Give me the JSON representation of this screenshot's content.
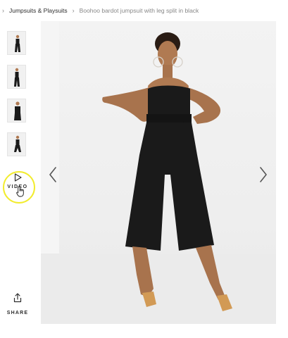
{
  "breadcrumb": {
    "items": [
      {
        "label": "Jumpsuits & Playsuits"
      }
    ],
    "current": "Boohoo bardot jumpsuit with leg split in black"
  },
  "gallery": {
    "thumbnail_count": 4,
    "video_label": "VIDEO",
    "share_label": "SHARE"
  },
  "colors": {
    "garment": "#1a1a1a",
    "skin": "#b07a52",
    "background": "#efefef",
    "cursor_highlight": "#f2ec2d",
    "text": "#2d2d2d",
    "muted": "#888888"
  },
  "icons": {
    "prev": "chevron-left-icon",
    "next": "chevron-right-icon",
    "video": "play-icon",
    "share": "share-icon",
    "cursor": "hand-pointer-icon"
  }
}
